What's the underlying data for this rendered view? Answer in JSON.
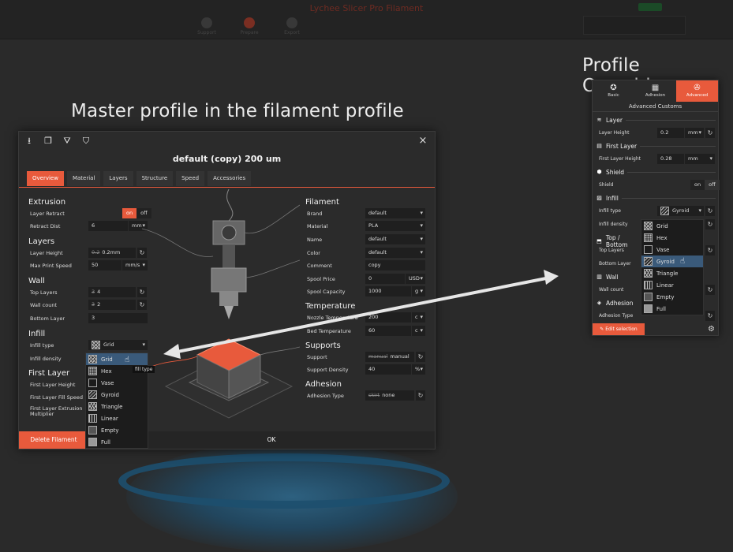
{
  "topbar": {
    "app_title": "Lychee Slicer Pro Filament",
    "steps": [
      "Support",
      "Prepare",
      "Export"
    ]
  },
  "captions": {
    "master": "Master profile in the filament profile",
    "overrides": "Profile Overrides"
  },
  "dialog": {
    "title": "default (copy) 200 um",
    "close": "×",
    "tabs": [
      "Overview",
      "Material",
      "Layers",
      "Structure",
      "Speed",
      "Accessories"
    ],
    "active_tab": "Overview",
    "extrusion": {
      "title": "Extrusion",
      "layer_retract_label": "Layer Retract",
      "toggle_on": "on",
      "toggle_off": "off",
      "retract_dist_label": "Retract Dist",
      "retract_dist_value": "6",
      "retract_dist_unit": "mm"
    },
    "layers": {
      "title": "Layers",
      "layer_height_label": "Layer Height",
      "layer_height_old": "0.2",
      "layer_height_value": "0.2mm",
      "max_speed_label": "Max Print Speed",
      "max_speed_value": "50",
      "max_speed_unit": "mm/s"
    },
    "wall": {
      "title": "Wall",
      "top_layers_label": "Top Layers",
      "top_layers_old": "3",
      "top_layers_value": "4",
      "wall_count_label": "Wall count",
      "wall_count_old": "3",
      "wall_count_value": "2",
      "bottom_layer_label": "Bottom Layer",
      "bottom_layer_value": "3"
    },
    "infill": {
      "title": "Infill",
      "type_label": "Infill type",
      "type_value": "Grid",
      "density_label": "Infill density",
      "tooltip": "fill type"
    },
    "first_layer": {
      "title": "First Layer",
      "height_label": "First Layer Height",
      "fill_speed_label": "First Layer Fill Speed",
      "extrusion_label_1": "First Layer Extrusion",
      "extrusion_label_2": "Multiplier"
    },
    "filament": {
      "title": "Filament",
      "brand_label": "Brand",
      "brand_value": "default",
      "material_label": "Material",
      "material_value": "PLA",
      "name_label": "Name",
      "name_value": "default",
      "color_label": "Color",
      "color_value": "default",
      "comment_label": "Comment",
      "comment_value": "copy",
      "price_label": "Spool Price",
      "price_value": "0",
      "price_unit": "USD",
      "capacity_label": "Spool Capacity",
      "capacity_value": "1000",
      "capacity_unit": "g"
    },
    "temperature": {
      "title": "Temperature",
      "nozzle_label": "Nozzle Temperature",
      "nozzle_value": "200",
      "nozzle_unit": "c",
      "bed_label": "Bed Temperature",
      "bed_value": "60",
      "bed_unit": "c"
    },
    "supports": {
      "title": "Supports",
      "support_label": "Support",
      "support_old": "manual",
      "support_value": "manual",
      "density_label": "Support Density",
      "density_value": "40",
      "density_unit": "%"
    },
    "adhesion": {
      "title": "Adhesion",
      "type_label": "Adhesion Type",
      "type_old": "skirt",
      "type_value": "none"
    },
    "footer": {
      "delete": "Delete Filament",
      "ok": "OK"
    }
  },
  "infill_options": [
    "Grid",
    "Hex",
    "Vase",
    "Gyroid",
    "Triangle",
    "Linear",
    "Empty",
    "Full"
  ],
  "panel": {
    "tabs": [
      "Basic",
      "Adhesion",
      "Advanced"
    ],
    "active_tab": "Advanced",
    "header": "Advanced Customs",
    "layer": {
      "title": "Layer",
      "height_label": "Layer Height",
      "height_value": "0.2",
      "height_unit": "mm"
    },
    "first_layer": {
      "title": "First Layer",
      "height_label": "First Layer Height",
      "height_value": "0.28",
      "height_unit": "mm"
    },
    "shield": {
      "title": "Shield",
      "label": "Shield",
      "on": "on",
      "off": "off"
    },
    "infill": {
      "title": "Infill",
      "type_label": "Infill type",
      "type_value": "Gyroid",
      "density_label": "Infill density"
    },
    "top_bottom": {
      "title": "Top / Bottom",
      "top_label": "Top Layers",
      "bottom_label": "Bottom Layer"
    },
    "wall": {
      "title": "Wall",
      "count_label": "Wall count"
    },
    "adhesion": {
      "title": "Adhesion",
      "type_label": "Adhesion Type"
    },
    "edit_button": "Edit selection"
  },
  "colors": {
    "accent": "#e85a3c",
    "selected": "#3a5a7a",
    "background": "#2a2a2a"
  }
}
